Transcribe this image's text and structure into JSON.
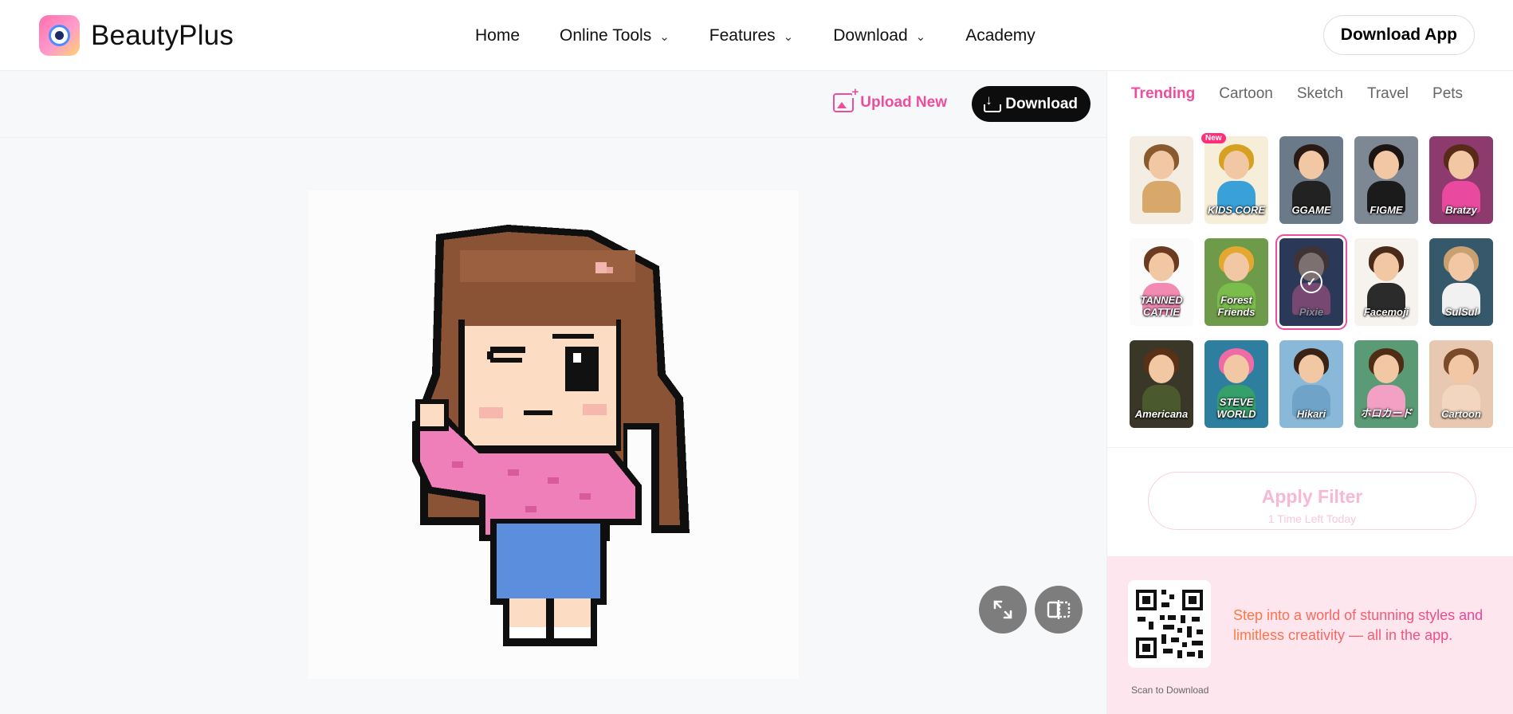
{
  "header": {
    "brand": "BeautyPlus",
    "nav": [
      {
        "label": "Home",
        "dropdown": false
      },
      {
        "label": "Online Tools",
        "dropdown": true
      },
      {
        "label": "Features",
        "dropdown": true
      },
      {
        "label": "Download",
        "dropdown": true
      },
      {
        "label": "Academy",
        "dropdown": false
      }
    ],
    "cta": "Download App"
  },
  "toolbar": {
    "upload_label": "Upload New",
    "download_label": "Download"
  },
  "panel": {
    "tabs": [
      {
        "label": "Trending",
        "active": true
      },
      {
        "label": "Cartoon",
        "active": false
      },
      {
        "label": "Sketch",
        "active": false
      },
      {
        "label": "Travel",
        "active": false
      },
      {
        "label": "Pets",
        "active": false
      }
    ],
    "new_badge": "New",
    "filters": [
      {
        "caption": "",
        "hair": "#8a5a2e",
        "body": "#d8a86a",
        "bg": "#f3ede4"
      },
      {
        "caption": "KIDS CORE",
        "hair": "#d6a020",
        "body": "#3aa0d8",
        "bg": "#f6eed8"
      },
      {
        "caption": "GGAME",
        "hair": "#2a1a14",
        "body": "#222",
        "bg": "#6b7a88"
      },
      {
        "caption": "FIGME",
        "hair": "#1a1412",
        "body": "#1b1b1b",
        "bg": "#7e8894"
      },
      {
        "caption": "Bratzy",
        "hair": "#5a2a18",
        "body": "#e94aa0",
        "bg": "#8d3a6e"
      },
      {
        "caption": "TANNED CATTIE",
        "hair": "#6b3a22",
        "body": "#f28ab2",
        "bg": "#fbfbfb"
      },
      {
        "caption": "Forest Friends",
        "hair": "#e2a830",
        "body": "#7bbd4c",
        "bg": "#6e9b4a"
      },
      {
        "caption": "Pixie",
        "hair": "#6a4026",
        "body": "#e46fa6",
        "bg": "#3d4d70"
      },
      {
        "caption": "Facemoji",
        "hair": "#4a2a18",
        "body": "#2b2b2b",
        "bg": "#f6f2ee"
      },
      {
        "caption": "SulSul",
        "hair": "#c9a070",
        "body": "#f1f1f1",
        "bg": "#35596b"
      },
      {
        "caption": "Americana",
        "hair": "#5a3016",
        "body": "#4a5a2e",
        "bg": "#3a3628"
      },
      {
        "caption": "STEVE WORLD",
        "hair": "#f06aa6",
        "body": "#36a06a",
        "bg": "#2e7ea0"
      },
      {
        "caption": "Hikari",
        "hair": "#3a2214",
        "body": "#6fa4c8",
        "bg": "#8ab8d8"
      },
      {
        "caption": "ホロカード",
        "hair": "#4e2c16",
        "body": "#f2a0c4",
        "bg": "#5a9a74"
      },
      {
        "caption": "Cartoon",
        "hair": "#7a4a2a",
        "body": "#f2d6c0",
        "bg": "#e8c8b0"
      }
    ],
    "apply_label": "Apply Filter",
    "apply_sub": "1 Time Left Today",
    "scan_label": "Scan to Download",
    "promo_text": "Step into a world of stunning styles and limitless creativity — all in the app."
  },
  "colors": {
    "accent": "#ee4d9c",
    "promo_bg": "#fde6ee",
    "dark_button": "#0d0d0d"
  }
}
